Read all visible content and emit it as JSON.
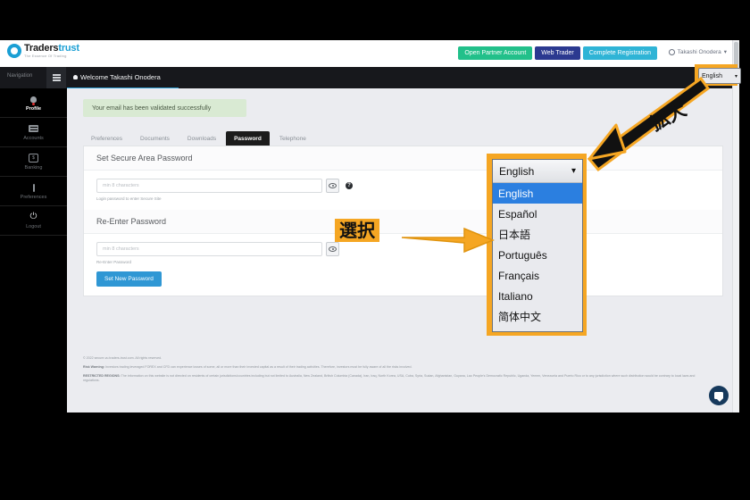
{
  "brand": {
    "name_primary": "Traders",
    "name_secondary": "trust",
    "tagline": "The Essence Of Trading",
    "logo_icon": "gear-circle-icon"
  },
  "header": {
    "buttons": [
      {
        "label": "Open Partner Account",
        "color": "#22c08a"
      },
      {
        "label": "Web Trader",
        "color": "#2b3990"
      },
      {
        "label": "Complete Registration",
        "color": "#2fb4d6"
      }
    ],
    "user_menu": {
      "label": "Takashi Onodera",
      "icon": "user-circle-icon",
      "caret": "▾"
    }
  },
  "navbar": {
    "nav_label": "Navigation",
    "menu_icon": "hamburger-icon",
    "welcome": "Welcome Takashi Onodera",
    "welcome_icon": "user-icon"
  },
  "sidebar": {
    "items": [
      {
        "label": "Profile",
        "icon": "user-avatar-icon",
        "active": true
      },
      {
        "label": "Accounts",
        "icon": "list-card-icon",
        "active": false
      },
      {
        "label": "Banking",
        "icon": "money-icon",
        "active": false
      },
      {
        "label": "Preferences",
        "icon": "dots-vertical-icon",
        "active": false
      },
      {
        "label": "Logout",
        "icon": "power-icon",
        "active": false
      }
    ]
  },
  "main": {
    "alert": "Your email has been validated successfully",
    "tabs": [
      {
        "label": "Preferences",
        "active": false
      },
      {
        "label": "Documents",
        "active": false
      },
      {
        "label": "Downloads",
        "active": false
      },
      {
        "label": "Password",
        "active": true
      },
      {
        "label": "Telephone",
        "active": false
      }
    ],
    "set_password": {
      "title": "Set Secure Area Password",
      "placeholder": "min 8 characters",
      "value": "",
      "hint": "Login password to enter Secure Site",
      "eye_icon": "eye-icon",
      "help_icon": "question-mark-icon"
    },
    "reenter_password": {
      "title": "Re-Enter Password",
      "placeholder": "min 8 characters",
      "value": "",
      "hint": "Re-Enter Password",
      "eye_icon": "eye-icon"
    },
    "submit_label": "Set New Password"
  },
  "legal": {
    "copyright": "© 2022 secure-vu.traders-trust.com. All rights reserved.",
    "risk_label": "Risk Warning:",
    "risk_text": " Investors trading leveraged FOREX and CFD can experience losses of some, all or more than their invested capital as a result of their trading activities. Therefore, investors must be fully aware of all the risks involved.",
    "restricted_label": "RESTRICTED REGIONS:",
    "restricted_text": " The information on this website is not directed on residents of certain jurisdictions/countries including but not limited to Australia, New Zealand, British Columbia (Canada), Iran, Iraq, North Korea, USA, Cuba, Syria, Sudan, Afghanistan, Guyana, Lao People's Democratic Republic, Uganda, Yemen, Venezuela and Puerto Rico or to any jurisdiction where such distribution would be contrary to local laws and regulations."
  },
  "language_selector": {
    "selected": "English",
    "caret": "⌄",
    "highlight_color": "#f5a623",
    "options": [
      {
        "label": "English",
        "selected": true
      },
      {
        "label": "Español",
        "selected": false
      },
      {
        "label": "日本語",
        "selected": false
      },
      {
        "label": "Português",
        "selected": false
      },
      {
        "label": "Français",
        "selected": false
      },
      {
        "label": "Italiano",
        "selected": false
      },
      {
        "label": "简体中文",
        "selected": false
      }
    ]
  },
  "annotations": [
    {
      "text": "選択",
      "style": "box",
      "arrow": "orange-arrow-right"
    },
    {
      "text": "拡大",
      "style": "plain",
      "arrow": "black-arrow-up-right"
    }
  ],
  "chat_widget": {
    "icon": "chat-bubble-icon"
  }
}
